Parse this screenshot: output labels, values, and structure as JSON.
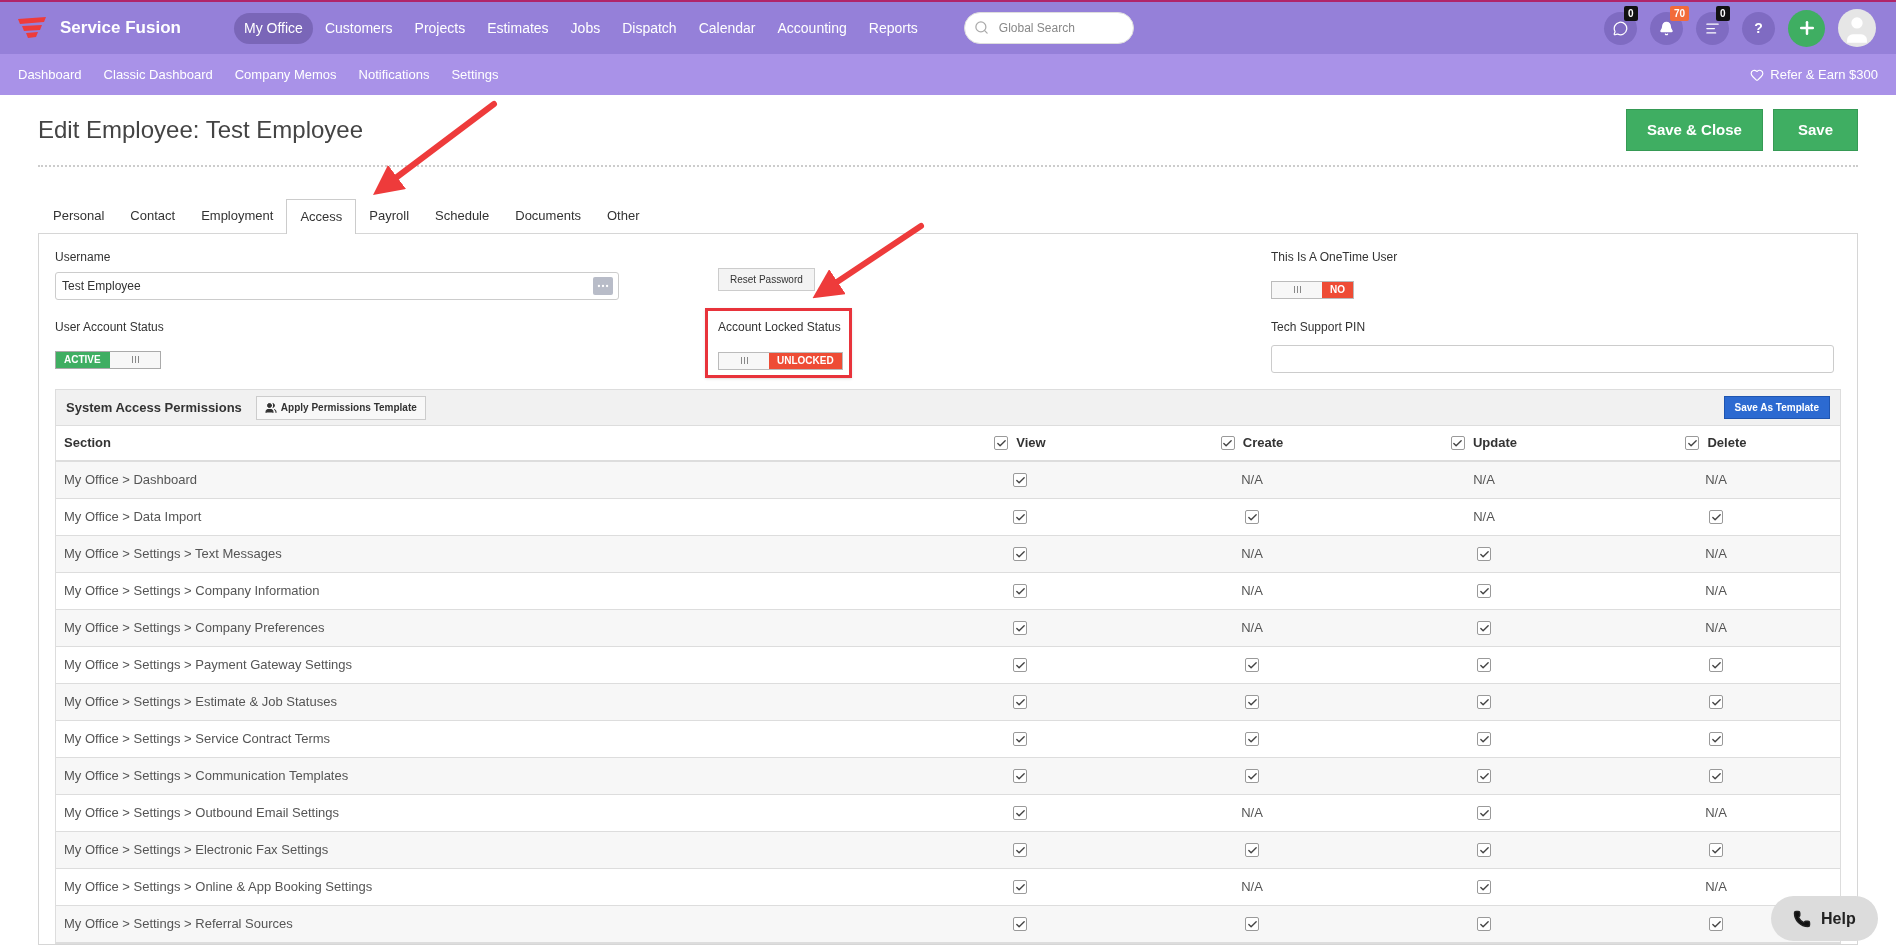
{
  "brand": {
    "name": "Service Fusion"
  },
  "main_nav": [
    {
      "label": "My Office",
      "selected": true
    },
    {
      "label": "Customers",
      "selected": false
    },
    {
      "label": "Projects",
      "selected": false
    },
    {
      "label": "Estimates",
      "selected": false
    },
    {
      "label": "Jobs",
      "selected": false
    },
    {
      "label": "Dispatch",
      "selected": false
    },
    {
      "label": "Calendar",
      "selected": false
    },
    {
      "label": "Accounting",
      "selected": false
    },
    {
      "label": "Reports",
      "selected": false
    }
  ],
  "search": {
    "placeholder": "Global Search"
  },
  "header_icons": [
    {
      "kind": "chat",
      "badge": "0",
      "color": "#111111"
    },
    {
      "kind": "bell",
      "badge": "70",
      "color": "#f26b3a"
    },
    {
      "kind": "list",
      "badge": "0",
      "color": "#111111"
    },
    {
      "kind": "help",
      "text": "?"
    },
    {
      "kind": "add"
    },
    {
      "kind": "avatar"
    }
  ],
  "sub_nav": [
    "Dashboard",
    "Classic Dashboard",
    "Company Memos",
    "Notifications",
    "Settings"
  ],
  "refer": "Refer & Earn $300",
  "page_title": "Edit Employee: Test Employee",
  "actions": [
    "Save & Close",
    "Save"
  ],
  "tabs": [
    {
      "label": "Personal",
      "selected": false
    },
    {
      "label": "Contact",
      "selected": false
    },
    {
      "label": "Employment",
      "selected": false
    },
    {
      "label": "Access",
      "selected": true
    },
    {
      "label": "Payroll",
      "selected": false
    },
    {
      "label": "Schedule",
      "selected": false
    },
    {
      "label": "Documents",
      "selected": false
    },
    {
      "label": "Other",
      "selected": false
    }
  ],
  "username": {
    "label": "Username",
    "value": "Test Employee"
  },
  "reset_password": "Reset Password",
  "user_account_status": {
    "label": "User Account Status",
    "on": true,
    "state_text": "ACTIVE"
  },
  "account_locked_status": {
    "label": "Account Locked Status",
    "on": false,
    "state_text": "UNLOCKED"
  },
  "onetime_user": {
    "label": "This Is A OneTime User",
    "on": false,
    "state_text": "NO"
  },
  "tech_support_pin": {
    "label": "Tech Support PIN"
  },
  "permissions": {
    "title": "System Access Permissions",
    "apply_template": "Apply Permissions Template",
    "save_template": "Save As Template",
    "columns": [
      {
        "label": "Section"
      },
      {
        "label": "View",
        "checked": true
      },
      {
        "label": "Create",
        "checked": true
      },
      {
        "label": "Update",
        "checked": true
      },
      {
        "label": "Delete",
        "checked": true
      }
    ],
    "rows": [
      {
        "cells": [
          {
            "kind": "text",
            "text": "My Office > Dashboard"
          },
          {
            "kind": "check",
            "checked": true
          },
          {
            "kind": "text",
            "text": "N/A"
          },
          {
            "kind": "text",
            "text": "N/A"
          },
          {
            "kind": "text",
            "text": "N/A"
          }
        ]
      },
      {
        "cells": [
          {
            "kind": "text",
            "text": "My Office > Data Import"
          },
          {
            "kind": "check",
            "checked": true
          },
          {
            "kind": "check",
            "checked": true
          },
          {
            "kind": "text",
            "text": "N/A"
          },
          {
            "kind": "check",
            "checked": true
          }
        ]
      },
      {
        "cells": [
          {
            "kind": "text",
            "text": "My Office > Settings > Text Messages"
          },
          {
            "kind": "check",
            "checked": true
          },
          {
            "kind": "text",
            "text": "N/A"
          },
          {
            "kind": "check",
            "checked": true
          },
          {
            "kind": "text",
            "text": "N/A"
          }
        ]
      },
      {
        "cells": [
          {
            "kind": "text",
            "text": "My Office > Settings > Company Information"
          },
          {
            "kind": "check",
            "checked": true
          },
          {
            "kind": "text",
            "text": "N/A"
          },
          {
            "kind": "check",
            "checked": true
          },
          {
            "kind": "text",
            "text": "N/A"
          }
        ]
      },
      {
        "cells": [
          {
            "kind": "text",
            "text": "My Office > Settings > Company Preferences"
          },
          {
            "kind": "check",
            "checked": true
          },
          {
            "kind": "text",
            "text": "N/A"
          },
          {
            "kind": "check",
            "checked": true
          },
          {
            "kind": "text",
            "text": "N/A"
          }
        ]
      },
      {
        "cells": [
          {
            "kind": "text",
            "text": "My Office > Settings > Payment Gateway Settings"
          },
          {
            "kind": "check",
            "checked": true
          },
          {
            "kind": "check",
            "checked": true
          },
          {
            "kind": "check",
            "checked": true
          },
          {
            "kind": "check",
            "checked": true
          }
        ]
      },
      {
        "cells": [
          {
            "kind": "text",
            "text": "My Office > Settings > Estimate & Job Statuses"
          },
          {
            "kind": "check",
            "checked": true
          },
          {
            "kind": "check",
            "checked": true
          },
          {
            "kind": "check",
            "checked": true
          },
          {
            "kind": "check",
            "checked": true
          }
        ]
      },
      {
        "cells": [
          {
            "kind": "text",
            "text": "My Office > Settings > Service Contract Terms"
          },
          {
            "kind": "check",
            "checked": true
          },
          {
            "kind": "check",
            "checked": true
          },
          {
            "kind": "check",
            "checked": true
          },
          {
            "kind": "check",
            "checked": true
          }
        ]
      },
      {
        "cells": [
          {
            "kind": "text",
            "text": "My Office > Settings > Communication Templates"
          },
          {
            "kind": "check",
            "checked": true
          },
          {
            "kind": "check",
            "checked": true
          },
          {
            "kind": "check",
            "checked": true
          },
          {
            "kind": "check",
            "checked": true
          }
        ]
      },
      {
        "cells": [
          {
            "kind": "text",
            "text": "My Office > Settings > Outbound Email Settings"
          },
          {
            "kind": "check",
            "checked": true
          },
          {
            "kind": "text",
            "text": "N/A"
          },
          {
            "kind": "check",
            "checked": true
          },
          {
            "kind": "text",
            "text": "N/A"
          }
        ]
      },
      {
        "cells": [
          {
            "kind": "text",
            "text": "My Office > Settings > Electronic Fax Settings"
          },
          {
            "kind": "check",
            "checked": true
          },
          {
            "kind": "check",
            "checked": true
          },
          {
            "kind": "check",
            "checked": true
          },
          {
            "kind": "check",
            "checked": true
          }
        ]
      },
      {
        "cells": [
          {
            "kind": "text",
            "text": "My Office > Settings > Online & App Booking Settings"
          },
          {
            "kind": "check",
            "checked": true
          },
          {
            "kind": "text",
            "text": "N/A"
          },
          {
            "kind": "check",
            "checked": true
          },
          {
            "kind": "text",
            "text": "N/A"
          }
        ]
      },
      {
        "cells": [
          {
            "kind": "text",
            "text": "My Office > Settings > Referral Sources"
          },
          {
            "kind": "check",
            "checked": true
          },
          {
            "kind": "check",
            "checked": true
          },
          {
            "kind": "check",
            "checked": true
          },
          {
            "kind": "check",
            "checked": true
          }
        ]
      }
    ]
  },
  "help": "Help"
}
